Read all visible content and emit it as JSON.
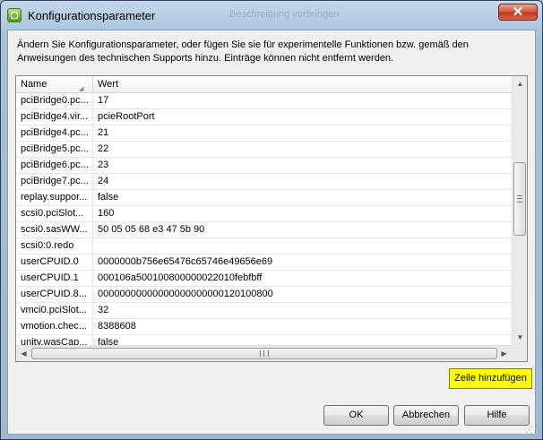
{
  "window": {
    "title": "Konfigurationsparameter",
    "background_title": "Beschreibung vorbringen",
    "close_label": "✕"
  },
  "description": "Ändern Sie Konfigurationsparameter, oder fügen Sie sie für experimentelle Funktionen bzw. gemäß den Anweisungen des technischen Supports hinzu. Einträge können nicht entfernt werden.",
  "table": {
    "columns": [
      "Name",
      "Wert"
    ],
    "rows": [
      {
        "name": "pciBridge0.pc...",
        "value": "17"
      },
      {
        "name": "pciBridge4.vir...",
        "value": "pcieRootPort"
      },
      {
        "name": "pciBridge4.pc...",
        "value": "21"
      },
      {
        "name": "pciBridge5.pc...",
        "value": "22"
      },
      {
        "name": "pciBridge6.pc...",
        "value": "23"
      },
      {
        "name": "pciBridge7.pc...",
        "value": "24"
      },
      {
        "name": "replay.suppor...",
        "value": "false"
      },
      {
        "name": "scsi0.pciSlot...",
        "value": "160"
      },
      {
        "name": "scsi0.sasWW...",
        "value": "50 05 05 68 e3 47 5b 90"
      },
      {
        "name": "scsi0:0.redo",
        "value": ""
      },
      {
        "name": "userCPUID.0",
        "value": "0000000b756e65476c65746e49656e69"
      },
      {
        "name": "userCPUID.1",
        "value": "000106a500100800000022010febfbff"
      },
      {
        "name": "userCPUID.8...",
        "value": "00000000000000000000000120100800"
      },
      {
        "name": "vmci0.pciSlot...",
        "value": "32"
      },
      {
        "name": "vmotion.chec...",
        "value": "8388608"
      },
      {
        "name": "unity.wasCap...",
        "value": "false"
      }
    ]
  },
  "buttons": {
    "add_row": "Zeile hinzufügen",
    "ok": "OK",
    "cancel": "Abbrechen",
    "help": "Hilfe"
  },
  "colors": {
    "highlight": "#ffff00"
  }
}
